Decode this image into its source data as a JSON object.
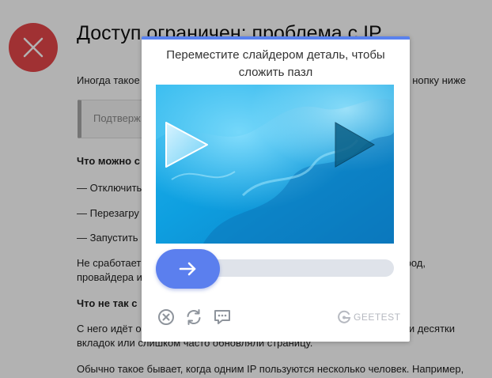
{
  "background": {
    "title": "Доступ ограничен: проблема с IP",
    "intro_left": "Иногда такое",
    "intro_right": "нопку ниже",
    "confirm_placeholder": "Подтверж",
    "what_to_do_heading": "Что можно с",
    "options": [
      "— Отключить",
      "— Перезагру",
      "— Запустить"
    ],
    "not_working_left_line1": "Не сработает",
    "not_working_right_line1": "род,",
    "not_working_left_line2": "провайдера и",
    "whats_wrong_heading": "Что не так с",
    "from_it_left": "С него идёт о",
    "from_it_right": "и десятки",
    "tabs_line": "вкладок или слишком часто обновляли страницу.",
    "usually_line": "Обычно такое бывает, когда одним IP пользуются несколько человек. Например,"
  },
  "captcha": {
    "title_line1": "Переместите слайдером деталь, чтобы",
    "title_line2": "сложить пазл",
    "slider_position": 0,
    "brand": "GEETEST",
    "accent_color": "#5b7fee",
    "top_bar_color": "#5a82ee",
    "icons": [
      "close-circle-icon",
      "refresh-icon",
      "feedback-icon",
      "geetest-logo-icon"
    ]
  }
}
